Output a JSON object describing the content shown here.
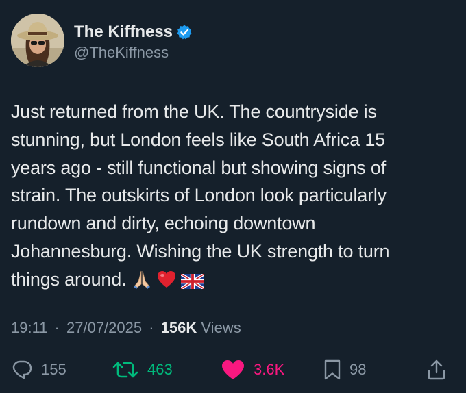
{
  "author": {
    "display_name": "The Kiffness",
    "handle": "@TheKiffness",
    "verified": true,
    "verified_color": "#1d9bf0"
  },
  "tweet": {
    "lines": [
      "Just returned from the UK. The countryside is",
      "stunning, but London feels like South Africa 15",
      "years ago - still functional but showing signs of",
      "strain. The outskirts of London look particularly",
      "rundown and dirty, echoing downtown",
      "Johannesburg. Wishing the UK strength to turn",
      "things around."
    ],
    "emojis": [
      "folded-hands-emoji",
      "red-heart-emoji",
      "uk-flag-emoji"
    ]
  },
  "meta": {
    "time": "19:11",
    "separator": "·",
    "date": "27/07/2025",
    "views_count": "156K",
    "views_label": "Views"
  },
  "actions": {
    "replies": "155",
    "retweets": "463",
    "likes": "3.6K",
    "bookmarks": "98"
  },
  "colors": {
    "background": "#15202b",
    "text": "#e7e9ea",
    "secondary": "#8b98a5",
    "retweet": "#00ba7c",
    "like": "#f91880"
  }
}
